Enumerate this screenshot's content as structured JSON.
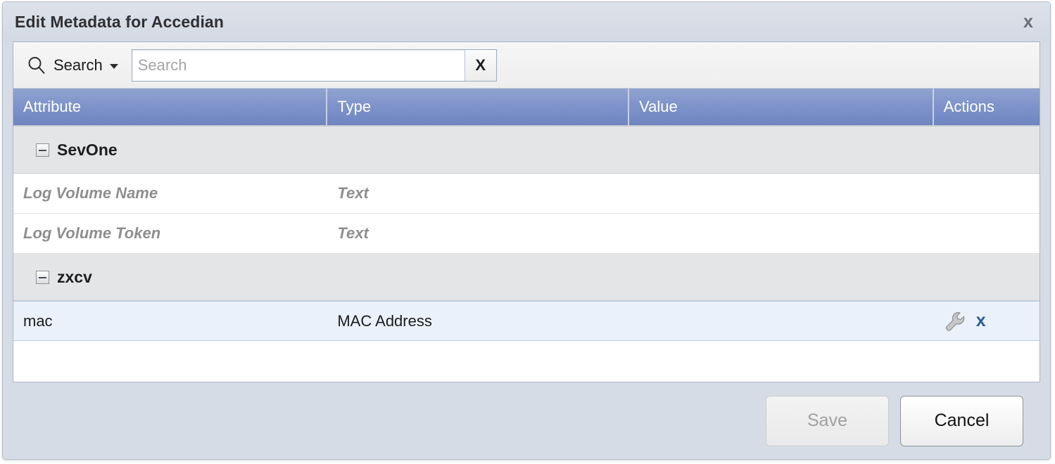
{
  "dialog": {
    "title": "Edit Metadata for Accedian",
    "close_label": "x"
  },
  "toolbar": {
    "search_icon": "search-icon",
    "search_trigger_label": "Search",
    "caret_icon": "chevron-down-icon",
    "search_value": "",
    "search_placeholder": "Search",
    "clear_label": "X"
  },
  "grid": {
    "columns": [
      {
        "label": "Attribute"
      },
      {
        "label": "Type"
      },
      {
        "label": "Value"
      },
      {
        "label": "Actions"
      }
    ],
    "groups": [
      {
        "label": "SevOne",
        "expander_icon": "minus-box-icon",
        "rows": [
          {
            "attribute": "Log Volume Name",
            "type": "Text",
            "value": "",
            "style": "placeholder",
            "selected": false,
            "actions": []
          },
          {
            "attribute": "Log Volume Token",
            "type": "Text",
            "value": "",
            "style": "placeholder",
            "selected": false,
            "actions": []
          }
        ]
      },
      {
        "label": "zxcv",
        "expander_icon": "minus-box-icon",
        "rows": [
          {
            "attribute": "mac",
            "type": "MAC Address",
            "value": "",
            "style": "normal",
            "selected": true,
            "actions": [
              {
                "icon": "wrench-icon",
                "label": ""
              },
              {
                "icon": "delete-x-icon",
                "label": "x"
              }
            ]
          }
        ]
      }
    ]
  },
  "footer": {
    "save_label": "Save",
    "save_disabled": true,
    "cancel_label": "Cancel"
  },
  "colors": {
    "header_blue": "#7e93c9",
    "selected_row": "#eaf1fa",
    "group_row": "#e4e5e7",
    "titlebar": "#d6dce5",
    "delete_blue": "#2c5d94"
  }
}
